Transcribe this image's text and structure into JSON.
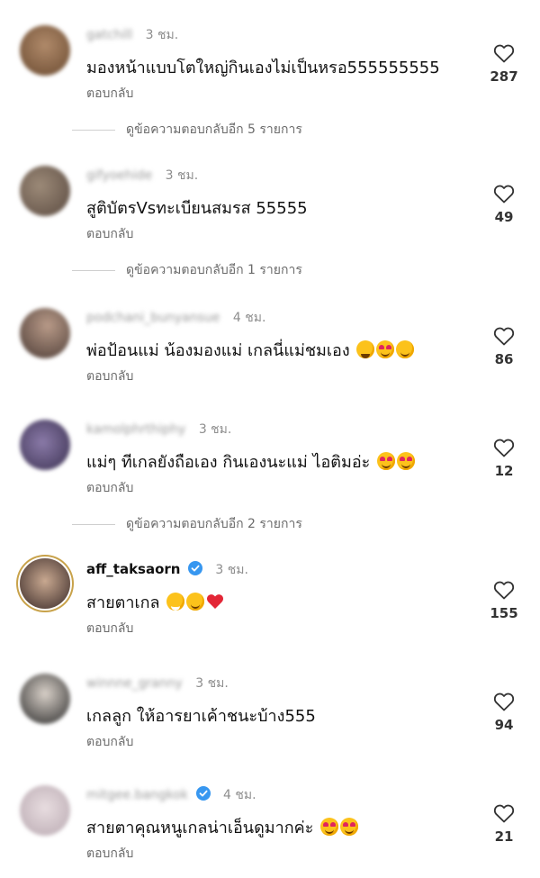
{
  "comments": [
    {
      "username": "gatchill",
      "username_blurred": true,
      "time": "3 ชม.",
      "text": "มองหน้าแบบโตใหญ่กินเองไม่เป็นหรอ555555555",
      "emojis": [],
      "reply_label": "ตอบกลับ",
      "likes": "287",
      "avatar_color": "#8a6a4a"
    },
    {
      "username": "gifyoehide",
      "username_blurred": true,
      "time": "3 ชม.",
      "text": "สูติบัตรVsทะเบียนสมรส 55555",
      "emojis": [],
      "reply_label": "ตอบกลับ",
      "likes": "49",
      "avatar_color": "#7a6a5e"
    },
    {
      "username": "podchani_bunyansue",
      "username_blurred": true,
      "time": "4 ชม.",
      "text": "พ่อป้อนแม่ น้องมองแม่ เกลนี่แม่ชมเอง",
      "emojis": [
        "laugh-cry-emoji",
        "heart-eyes-emoji",
        "smiling-hearts-emoji"
      ],
      "reply_label": "ตอบกลับ",
      "likes": "86",
      "avatar_color": "#5a4a44"
    },
    {
      "username": "kamolphrthiphy",
      "username_blurred": true,
      "time": "3 ชม.",
      "text": "แม่ๆ ทีเกลยังถือเอง กินเองนะแม่  ไอติมอ่ะ",
      "emojis": [
        "heart-eyes-emoji",
        "heart-eyes-emoji"
      ],
      "reply_label": "ตอบกลับ",
      "likes": "12",
      "avatar_color": "#5a5070"
    },
    {
      "username": "aff_taksaorn",
      "username_blurred": false,
      "verified": true,
      "time": "3 ชม.",
      "text": "สายตาเกล",
      "emojis": [
        "grin-emoji",
        "pleading-emoji",
        "red-heart-emoji"
      ],
      "reply_label": "ตอบกลับ",
      "likes": "155",
      "avatar_color": "#3a3030"
    },
    {
      "username": "winnne_granny",
      "username_blurred": true,
      "time": "3 ชม.",
      "text": "เกลลูก ให้อารยาเค้าชนะบ้าง555",
      "emojis": [],
      "reply_label": "ตอบกลับ",
      "likes": "94",
      "avatar_color": "#4a4a4a"
    },
    {
      "username": "mitgee.bangkok",
      "username_blurred": true,
      "verified": true,
      "time": "4 ชม.",
      "text": "สายตาคุณหนูเกลน่าเอ็นดูมากค่ะ",
      "emojis": [
        "heart-eyes-emoji",
        "heart-eyes-emoji"
      ],
      "reply_label": "ตอบกลับ",
      "likes": "21",
      "avatar_color": "#d8c8cc"
    }
  ],
  "view_more": [
    "ดูข้อความตอบกลับอีก 5 รายการ",
    "ดูข้อความตอบกลับอีก 1 รายการ",
    "ดูข้อความตอบกลับอีก 2 รายการ"
  ],
  "colors": {
    "secondary_text": "#8e8e8e",
    "verified_blue": "#3797f0"
  }
}
